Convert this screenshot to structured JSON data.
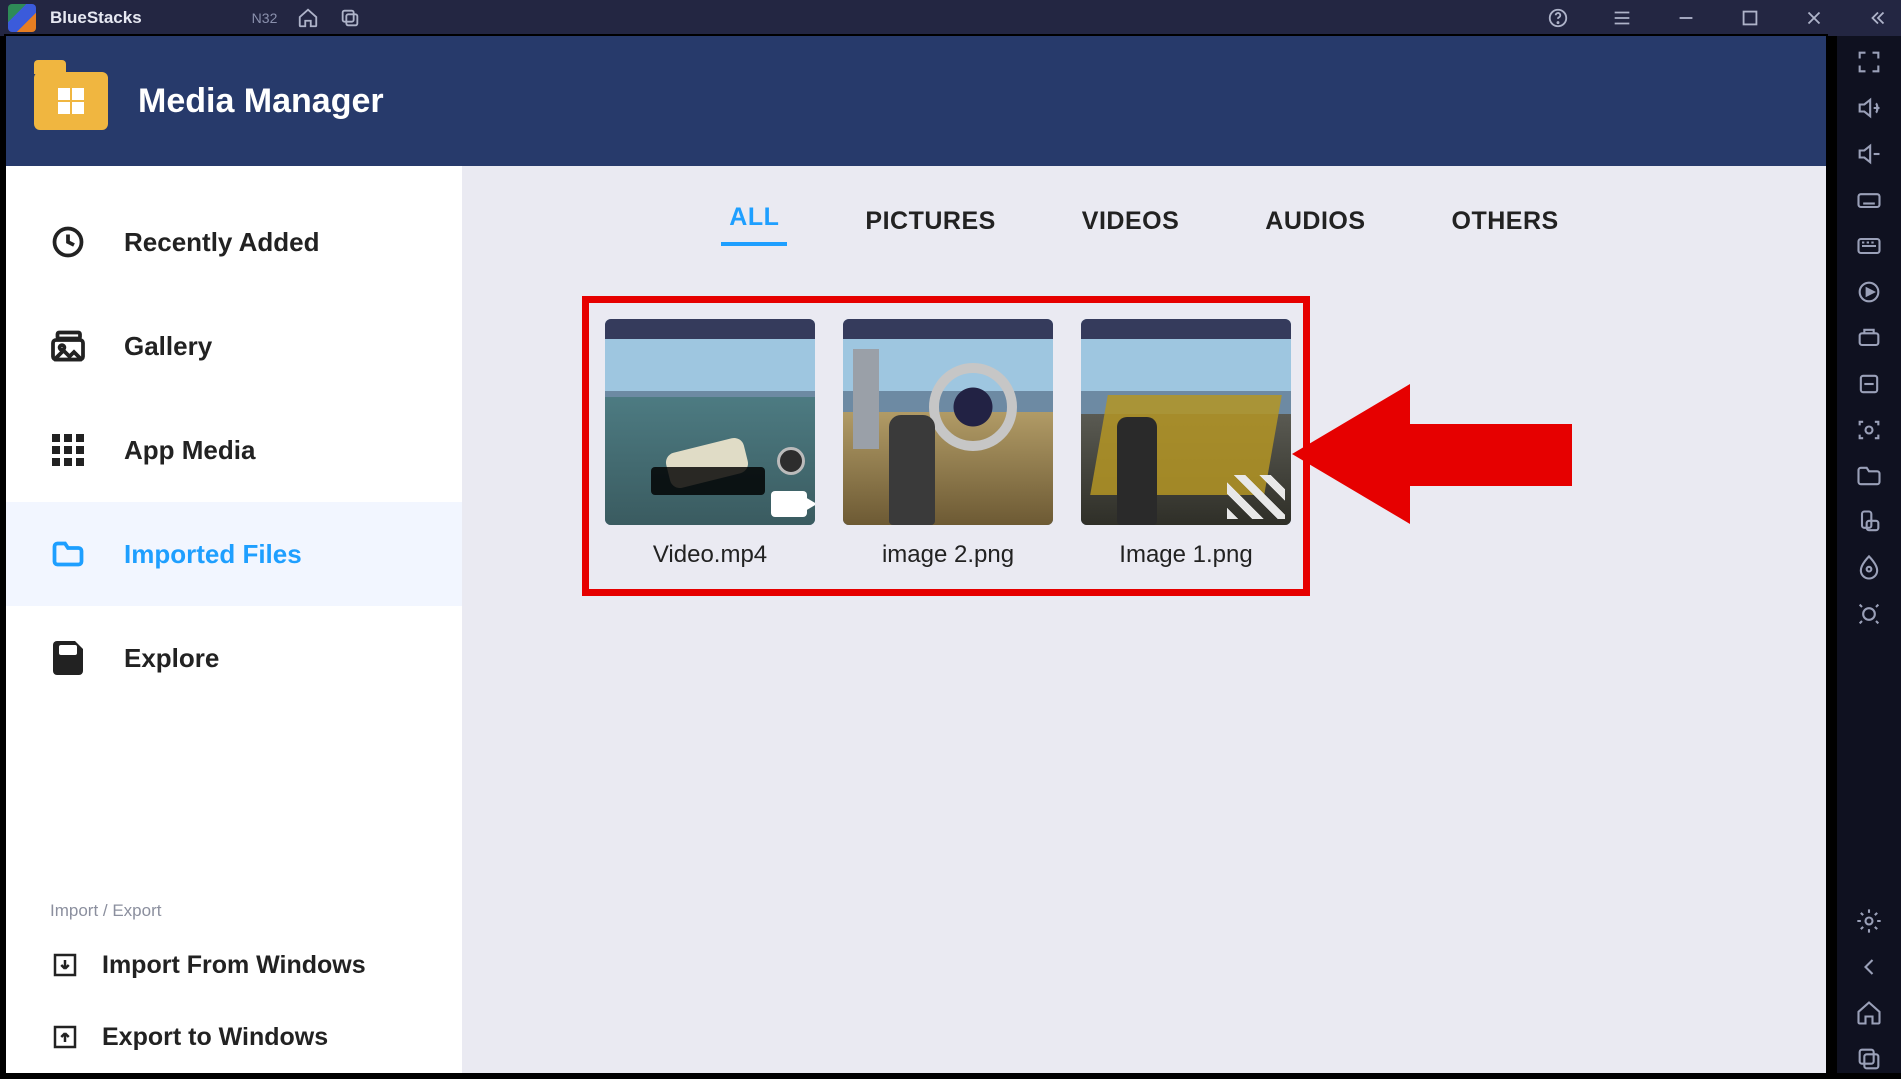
{
  "titlebar": {
    "brand": "BlueStacks",
    "badge": "N32"
  },
  "panel": {
    "title": "Media Manager"
  },
  "sidebar": {
    "items": [
      {
        "label": "Recently Added"
      },
      {
        "label": "Gallery"
      },
      {
        "label": "App Media"
      },
      {
        "label": "Imported Files"
      },
      {
        "label": "Explore"
      }
    ],
    "import_export_header": "Import / Export",
    "import_label": "Import From Windows",
    "export_label": "Export to Windows"
  },
  "tabs": {
    "items": [
      "ALL",
      "PICTURES",
      "VIDEOS",
      "AUDIOS",
      "OTHERS"
    ],
    "active": 0
  },
  "files": [
    {
      "name": "Video.mp4"
    },
    {
      "name": "image 2.png"
    },
    {
      "name": "Image 1.png"
    }
  ]
}
